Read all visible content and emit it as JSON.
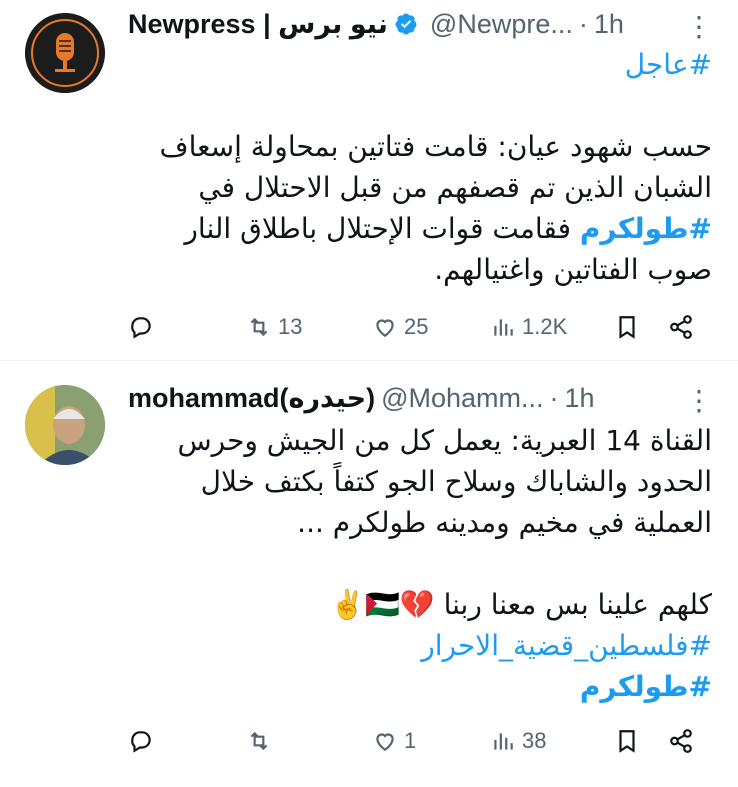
{
  "tweets": [
    {
      "author_name": "Newpress | نيو برس",
      "handle": "@Newpre...",
      "dot": "·",
      "time": "1h",
      "avatar_text": "NEWPRESS",
      "avatar_sub": "نيو برس",
      "lines": [
        "#عاجل",
        "",
        "حسب شهود عيان: قامت فتاتين بمحاولة إسعاف",
        "الشبان الذين تم قصفهم من قبل الاحتلال في",
        "#طولكرم فقامت  قوات الإحتلال باطلاق النار",
        "صوب الفتاتين واغتيالهم."
      ],
      "hashtag_1": "#عاجل",
      "body_line_1": "حسب شهود عيان: قامت فتاتين بمحاولة إسعاف",
      "body_line_2": "الشبان الذين تم قصفهم من قبل الاحتلال في",
      "body_line_3_tag": "#طولكرم",
      "body_line_3_rest": " فقامت  قوات الإحتلال باطلاق النار",
      "body_line_4": "صوب الفتاتين واغتيالهم.",
      "replies": "",
      "retweets": "13",
      "likes": "25",
      "views": "1.2K"
    },
    {
      "author_name": "mohammad(حيدره)",
      "handle": "@Mohamm...",
      "dot": "·",
      "time": "1h",
      "body_line_1": "القناة 14 العبرية: يعمل كل من الجيش وحرس",
      "body_line_2": "الحدود والشاباك وسلاح الجو كتفاً بكتف خلال",
      "body_line_3": "العملية في مخيم ومدينه طولكرم ...",
      "body_line_4": "كلهم علينا بس معنا ربنا 💔🇵🇸✌️",
      "hashtag_1": "#فلسطين_قضية_الاحرار",
      "hashtag_2": "#طولكرم",
      "replies": "",
      "retweets": "",
      "likes": "1",
      "views": "38"
    }
  ],
  "colors": {
    "accent": "#1d9bf0",
    "text": "#0f1419",
    "muted": "#536471"
  },
  "icons": [
    "reply-icon",
    "retweet-icon",
    "like-icon",
    "views-icon",
    "bookmark-icon",
    "share-icon",
    "verified-icon",
    "more-icon"
  ]
}
